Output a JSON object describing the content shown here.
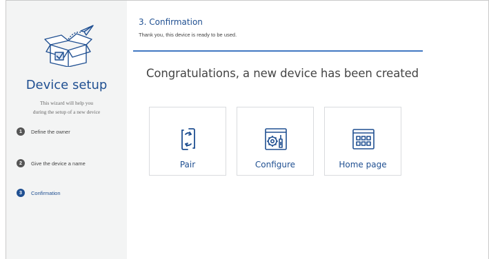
{
  "sidebar": {
    "title": "Device setup",
    "description_line1": "This wizard will help you",
    "description_line2": "during the setup of a new device",
    "steps": [
      {
        "number": "1",
        "label": "Define the owner",
        "state": "done"
      },
      {
        "number": "2",
        "label": "Give the device a name",
        "state": "done"
      },
      {
        "number": "3",
        "label": "Confirmation",
        "state": "active"
      }
    ],
    "illustration_icon": "open-box-with-paper-plane-icon"
  },
  "header": {
    "title": "3. Confirmation",
    "subtitle": "Thank you, this device is ready to be used."
  },
  "main": {
    "heading": "Congratulations, a new device has been created",
    "actions": [
      {
        "label": "Pair",
        "icon": "pair-sync-icon"
      },
      {
        "label": "Configure",
        "icon": "configure-gear-icon"
      },
      {
        "label": "Home page",
        "icon": "home-page-grid-icon"
      }
    ]
  },
  "colors": {
    "accent": "#1f4f91",
    "divider": "#3f76c2",
    "sidebar_bg": "#f3f4f4",
    "step_done": "#555555"
  }
}
